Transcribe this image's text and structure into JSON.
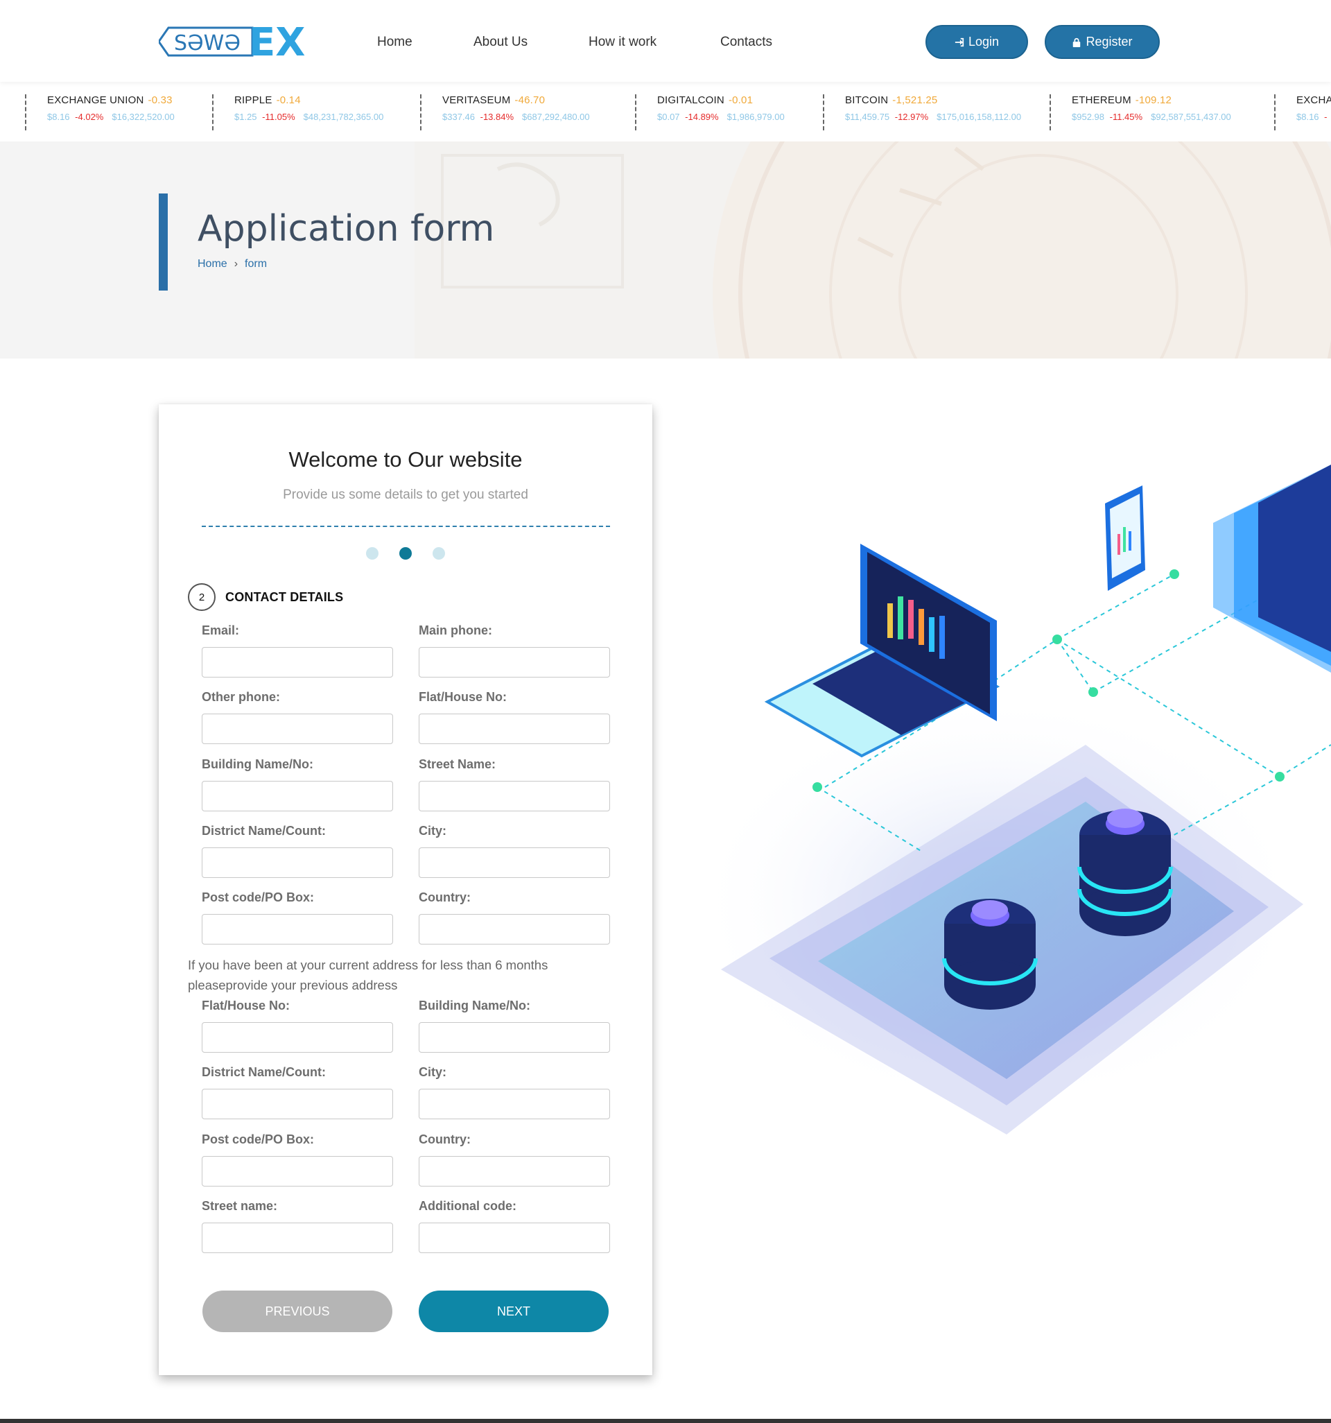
{
  "brand": {
    "logo_text_left": "SƏWƏ",
    "logo_text_right": "EX",
    "logo_colors": {
      "text": "#2a77b5",
      "ex": "#2fa3e0"
    }
  },
  "nav": {
    "home": "Home",
    "about": "About Us",
    "how": "How it work",
    "contacts": "Contacts"
  },
  "auth": {
    "login": "Login",
    "register": "Register"
  },
  "ticker": [
    {
      "name": "EXCHANGE UNION",
      "change": "-0.33",
      "price": "$8.16",
      "pct": "-4.02%",
      "cap": "$16,322,520.00"
    },
    {
      "name": "RIPPLE",
      "change": "-0.14",
      "price": "$1.25",
      "pct": "-11.05%",
      "cap": "$48,231,782,365.00"
    },
    {
      "name": "VERITASEUM",
      "change": "-46.70",
      "price": "$337.46",
      "pct": "-13.84%",
      "cap": "$687,292,480.00"
    },
    {
      "name": "DIGITALCOIN",
      "change": "-0.01",
      "price": "$0.07",
      "pct": "-14.89%",
      "cap": "$1,986,979.00"
    },
    {
      "name": "BITCOIN",
      "change": "-1,521.25",
      "price": "$11,459.75",
      "pct": "-12.97%",
      "cap": "$175,016,158,112.00"
    },
    {
      "name": "ETHEREUM",
      "change": "-109.12",
      "price": "$952.98",
      "pct": "-11.45%",
      "cap": "$92,587,551,437.00"
    },
    {
      "name": "EXCHA",
      "change": "",
      "price": "$8.16",
      "pct": "-",
      "cap": ""
    }
  ],
  "hero": {
    "title": "Application form",
    "breadcrumb_home": "Home",
    "breadcrumb_sep": "›",
    "breadcrumb_current": "form"
  },
  "form": {
    "title": "Welcome to Our website",
    "subtitle": "Provide us some details to get you started",
    "step_number": "2",
    "step_label": "CONTACT DETAILS",
    "current_step": 2,
    "total_steps": 3,
    "fields_main": [
      "Email:",
      "Main phone:",
      "Other phone:",
      "Flat/House No:",
      "Building Name/No:",
      "Street Name:",
      "District Name/Count:",
      "City:",
      "Post code/PO Box:",
      "Country:"
    ],
    "note": "If you have been at your current address for less than 6 months pleaseprovide your previous address",
    "fields_previous": [
      "Flat/House No:",
      "Building Name/No:",
      "District Name/Count:",
      "City:",
      "Post code/PO Box:",
      "Country:",
      "Street name:",
      "Additional code:"
    ],
    "previous_button": "PREVIOUS",
    "next_button": "NEXT"
  },
  "colors": {
    "primary": "#2473a6",
    "accent": "#0e87a7",
    "negative": "#e52b2b",
    "change": "#f0a93a"
  }
}
